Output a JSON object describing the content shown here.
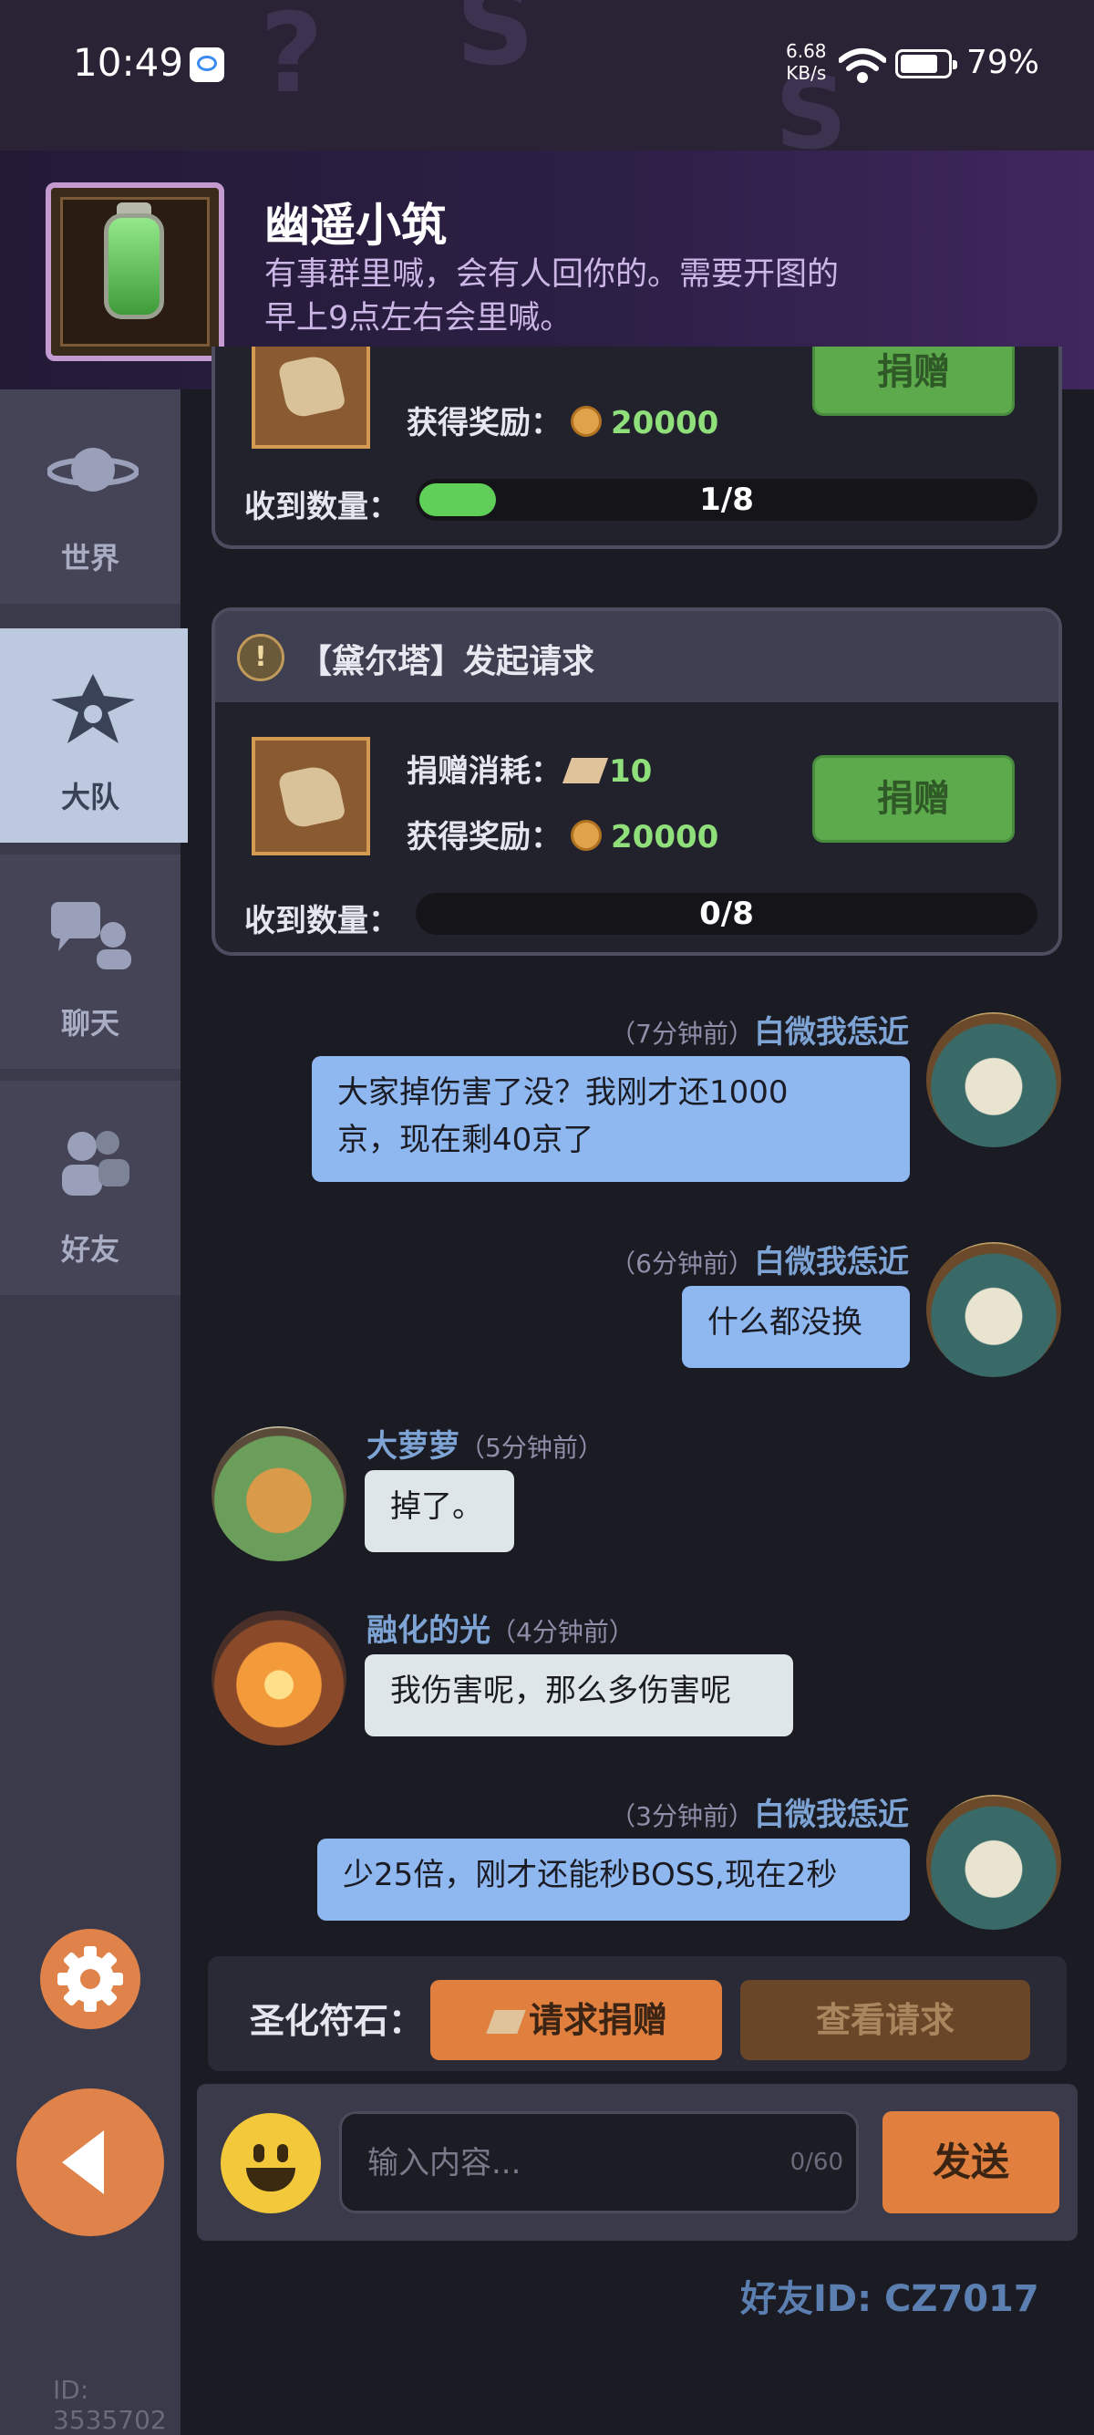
{
  "status_bar": {
    "time": "10:49",
    "net_speed": "6.68",
    "net_unit": "KB/s",
    "battery": "79%",
    "battery_level": 0.79
  },
  "guild": {
    "name": "幽遥小筑",
    "desc_line1": "有事群里喊，会有人回你的。需要开图的",
    "desc_line2": "早上9点左右会里喊。"
  },
  "sidebar": {
    "tabs": [
      {
        "label": "世界",
        "icon": "planet-icon"
      },
      {
        "label": "大队",
        "icon": "squad-icon"
      },
      {
        "label": "聊天",
        "icon": "chat-icon"
      },
      {
        "label": "好友",
        "icon": "friends-icon"
      }
    ],
    "active_tab": 1,
    "bottom_id": "ID: 3535702"
  },
  "requests": [
    {
      "reward_label": "获得奖励：",
      "reward_value": "20000",
      "button_label": "捐赠",
      "received_label": "收到数量：",
      "received_text": "1/8",
      "received_progress": 0.125
    },
    {
      "title": "【黛尔塔】发起请求",
      "cost_label": "捐赠消耗：",
      "cost_value": "10",
      "reward_label": "获得奖励：",
      "reward_value": "20000",
      "button_label": "捐赠",
      "received_label": "收到数量：",
      "received_text": "0/8",
      "received_progress": 0
    }
  ],
  "messages": [
    {
      "side": "right",
      "time": "（7分钟前）",
      "name": "白微我恁近",
      "line1": "大家掉伤害了没？我刚才还1000",
      "line2": "京，现在剩40京了",
      "avatar": "owl-avatar"
    },
    {
      "side": "right",
      "time": "（6分钟前）",
      "name": "白微我恁近",
      "text": "什么都没换",
      "avatar": "owl-avatar"
    },
    {
      "side": "left",
      "time": "（5分钟前）",
      "name": "大萝萝",
      "text": "掉了。",
      "avatar": "fox-avatar"
    },
    {
      "side": "left",
      "time": "（4分钟前）",
      "name": "融化的光",
      "text": "我伤害呢，那么多伤害呢",
      "avatar": "campfire-avatar"
    },
    {
      "side": "right",
      "time": "（3分钟前）",
      "name": "白微我恁近",
      "text": "少25倍，刚才还能秒BOSS,现在2秒",
      "avatar": "owl-avatar"
    }
  ],
  "rune_bar": {
    "label": "圣化符石：",
    "request_label": "请求捐赠",
    "view_label": "查看请求"
  },
  "input": {
    "placeholder": "输入内容...",
    "counter": "0/60",
    "send_label": "发送"
  },
  "friend_id": "好友ID: CZ7017"
}
